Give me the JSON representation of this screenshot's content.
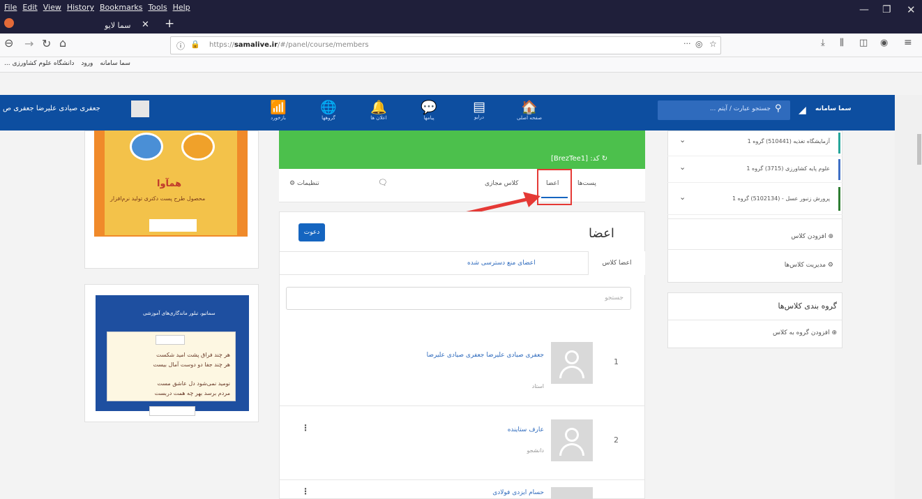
{
  "browser": {
    "menu": [
      "File",
      "Edit",
      "View",
      "History",
      "Bookmarks",
      "Tools",
      "Help"
    ],
    "tab_title": "سما لایو",
    "url_prefix": "https://",
    "url_domain": "samalive.ir",
    "url_path": "/#/panel/course/members",
    "bookmarks": [
      "سما سامانه",
      "ورود",
      "دانشگاه علوم کشاورزی ..."
    ]
  },
  "header": {
    "brand": "سما سامانه",
    "search_placeholder": "جستجو عبارت / آیتم ...",
    "nav": [
      {
        "label": "صفحه اصلی",
        "icon": "home-icon",
        "glyph": "🏠"
      },
      {
        "label": "درایو",
        "icon": "drive-icon",
        "glyph": "▤"
      },
      {
        "label": "پیامها",
        "icon": "chat-icon",
        "glyph": "💬"
      },
      {
        "label": "اعلان ها",
        "icon": "bell-icon",
        "glyph": "🔔"
      },
      {
        "label": "گروهها",
        "icon": "globe-icon",
        "glyph": "🌐"
      },
      {
        "label": "بازخورد",
        "icon": "rss-icon",
        "glyph": "📶"
      }
    ],
    "username": "جعفری صیادی علیرضا جعفری ص"
  },
  "ads": {
    "banner1_title": "همآوا",
    "banner1_sub": "محصول طرح پست دکتری تولید نرم‌افزار",
    "banner2_title": "سماتیو، تبلور ماندگاری‌های آموزشی",
    "banner2_lines": [
      "هر چند فراق پشت امید شکست",
      "هر چند جفا دو دوست آمال بیست",
      "نومید نمی‌شود دل عاشق مست",
      "مردم برسد بهر چه همت دربست"
    ]
  },
  "course": {
    "code_label": "کد: [BrezTee1]",
    "tabs": {
      "posts": "پست‌ها",
      "members": "اعضا",
      "virtual": "کلاس مجازی",
      "chat": "",
      "settings": "تنظیمات"
    }
  },
  "members": {
    "title": "اعضا",
    "invite": "دعوت",
    "subtab_all": "اعضا کلاس",
    "subtab_blocked": "اعضای منع دسترسی شده",
    "search_placeholder": "جستجو",
    "list": [
      {
        "num": "1",
        "name": "جعفری صیادی علیرضا جعفری صیادی علیرضا",
        "role": "استاد"
      },
      {
        "num": "2",
        "name": "عارف ستاینده",
        "role": "دانشجو"
      },
      {
        "num": "3",
        "name": "حسام ایزدی فولادی",
        "role": ""
      }
    ]
  },
  "classes": {
    "items": [
      {
        "name": "آزمایشگاه تغذیه (510441) گروه 1",
        "color": "#26a69a"
      },
      {
        "name": "علوم پایه کشاورزی (3715) گروه 1",
        "color": "#3f6fc4"
      },
      {
        "name": "پرورش زنبور عسل - (5102134) گروه 1",
        "color": "#2e7d32"
      }
    ],
    "add_class": "افزودن کلاس",
    "manage_classes": "مدیریت کلاس‌ها"
  },
  "groups": {
    "title": "گروه بندی کلاس‌ها",
    "add": "افزودن گروه به کلاس"
  }
}
